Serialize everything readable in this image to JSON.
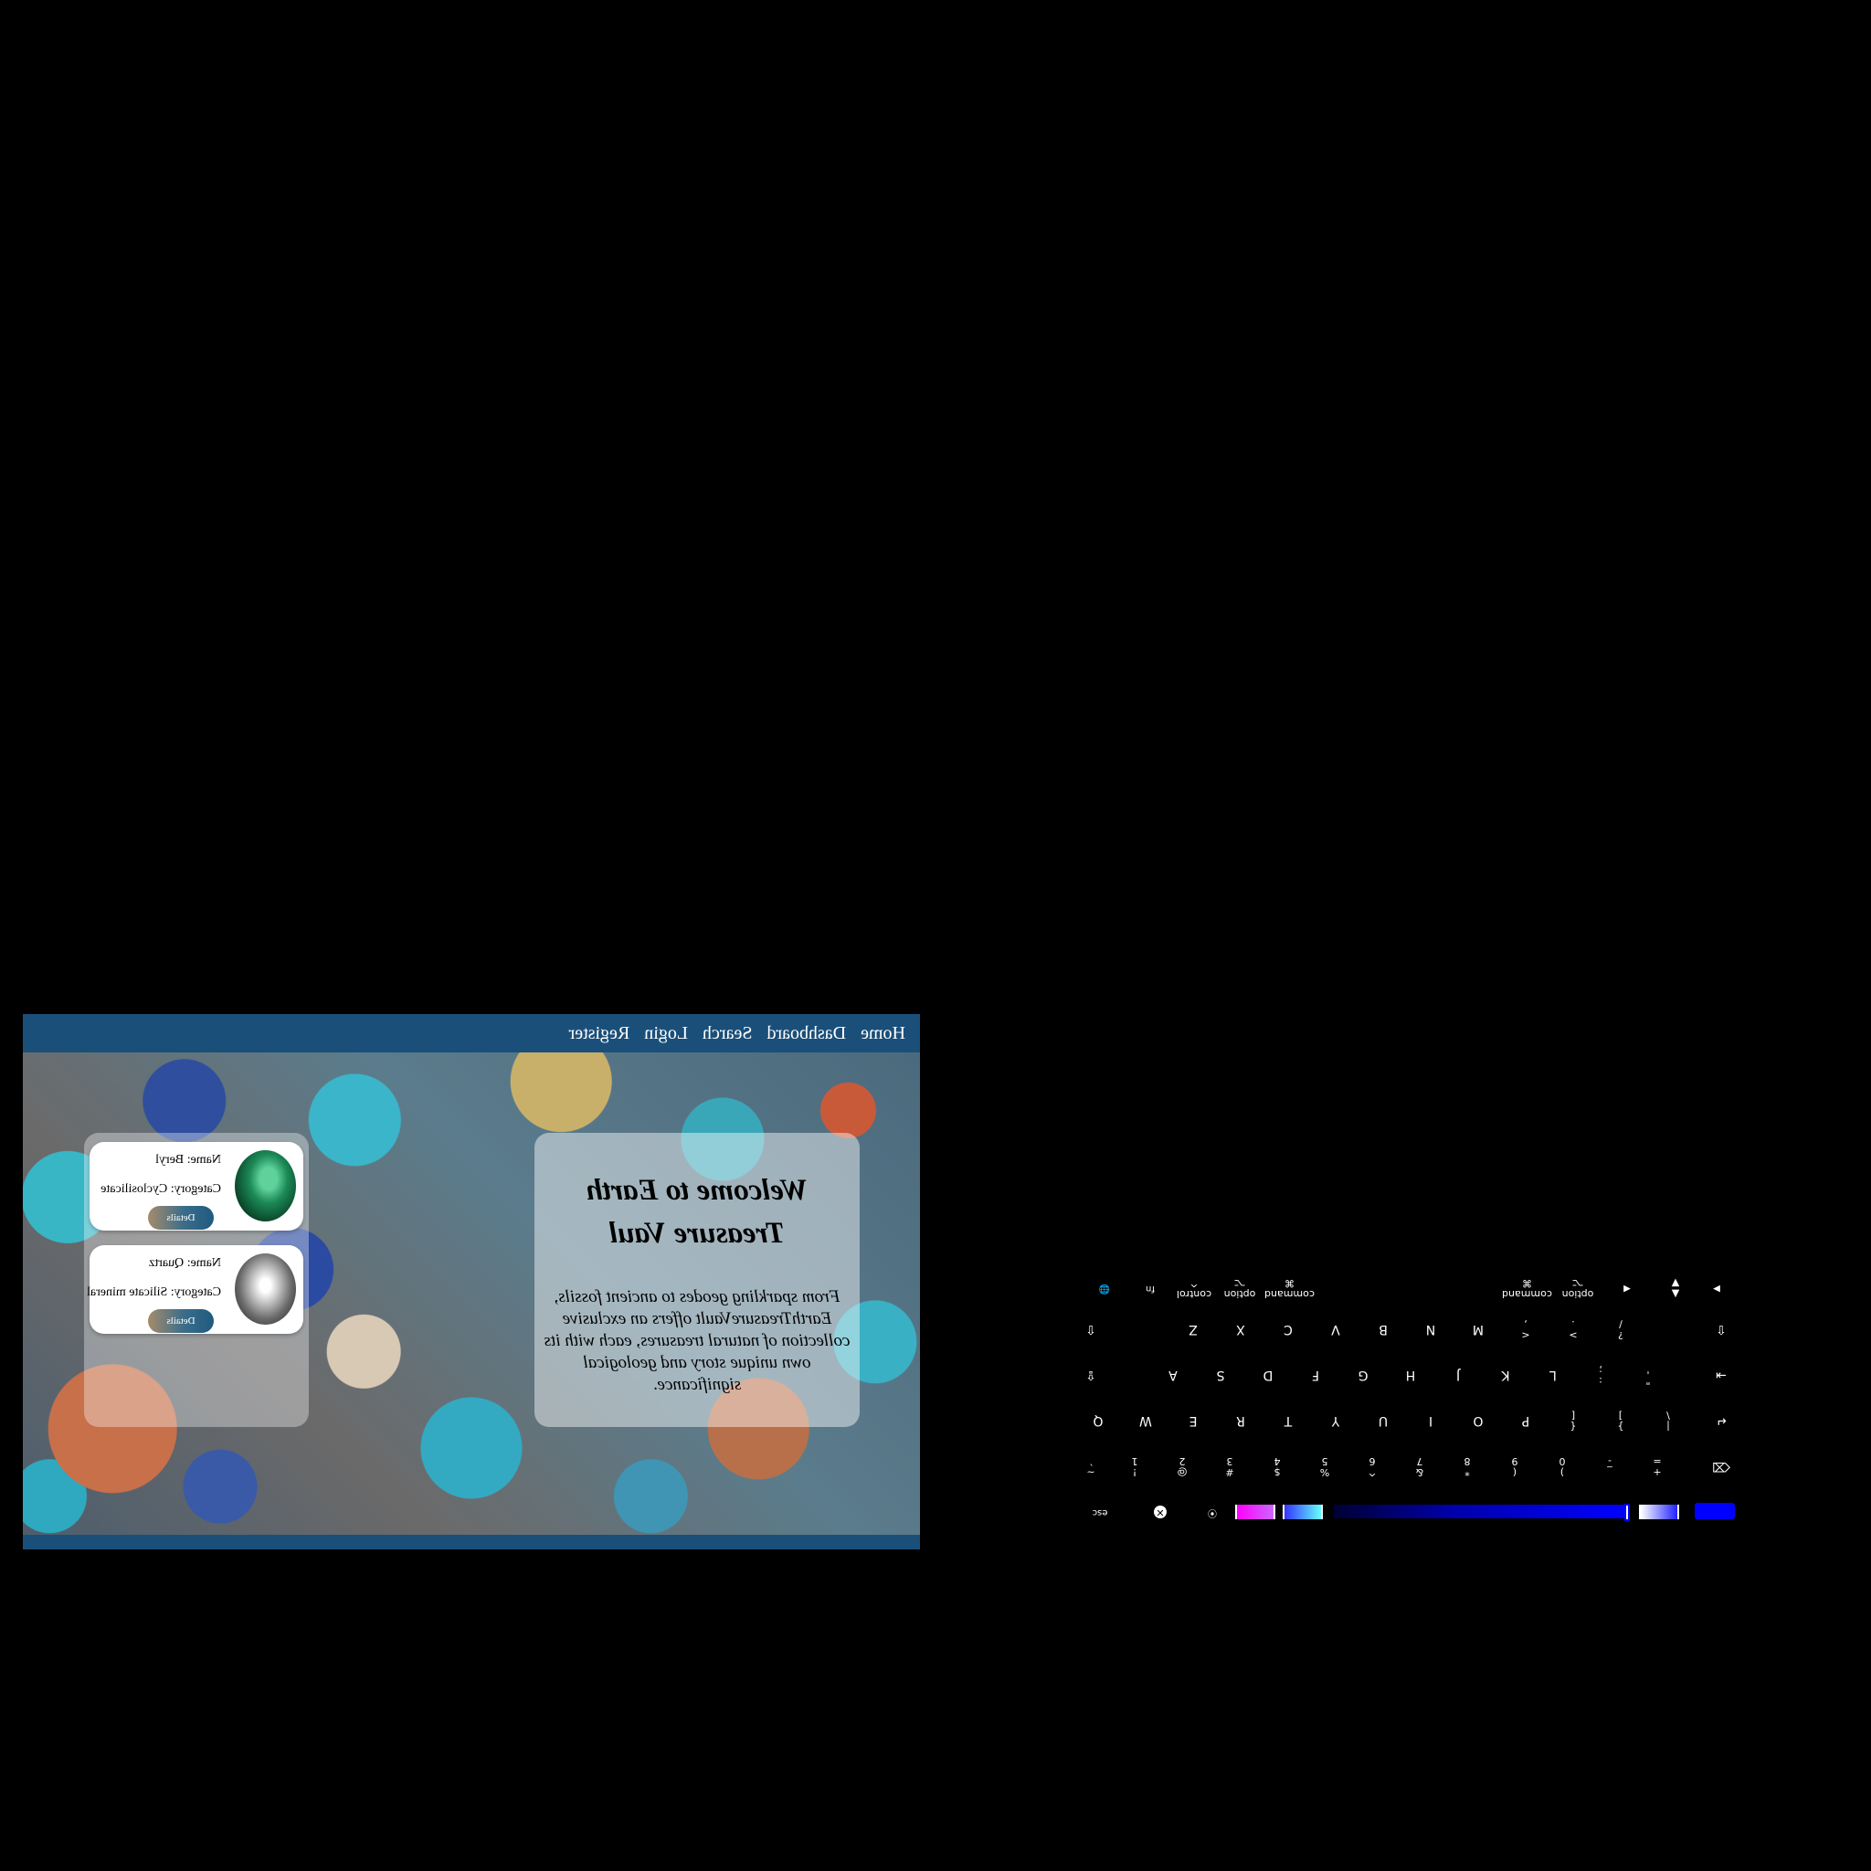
{
  "nav": {
    "items": [
      "Home",
      "Dashboard",
      "Search",
      "Login",
      "Register"
    ]
  },
  "welcome": {
    "title": "Welcome to Earth Treasure Vaul",
    "text": "From sparkling geodes to ancient fossils, EarthTreasureVault offers an exclusive collection of natural treasures, each with its own unique story and geological significance."
  },
  "gems": [
    {
      "name": "Name: Beryl",
      "category": "Category: Cyclosilicate",
      "button": "Details"
    },
    {
      "name": "Name: Quartz",
      "category": "Category: Silicate mineral",
      "button": "Details"
    }
  ],
  "keyboard": {
    "row_numbers": [
      {
        "top": "~",
        "bot": "`"
      },
      {
        "top": "!",
        "bot": "1"
      },
      {
        "top": "@",
        "bot": "2"
      },
      {
        "top": "#",
        "bot": "3"
      },
      {
        "top": "$",
        "bot": "4"
      },
      {
        "top": "%",
        "bot": "5"
      },
      {
        "top": "^",
        "bot": "6"
      },
      {
        "top": "&",
        "bot": "7"
      },
      {
        "top": "*",
        "bot": "8"
      },
      {
        "top": "(",
        "bot": "9"
      },
      {
        "top": ")",
        "bot": "0"
      },
      {
        "top": "_",
        "bot": "-"
      },
      {
        "top": "+",
        "bot": "="
      }
    ],
    "backspace": "⌫",
    "tab": "⇥",
    "row_q": [
      "Q",
      "W",
      "E",
      "R",
      "T",
      "Y",
      "U",
      "I",
      "O",
      "P"
    ],
    "row_q_extra": [
      {
        "top": "{",
        "bot": "["
      },
      {
        "top": "}",
        "bot": "]"
      },
      {
        "top": "|",
        "bot": "\\"
      }
    ],
    "return": "↵",
    "caps": "⇪",
    "row_a": [
      "A",
      "S",
      "D",
      "F",
      "G",
      "H",
      "J",
      "K",
      "L"
    ],
    "row_a_extra": [
      {
        "top": ":",
        "bot": ";"
      },
      {
        "top": "\"",
        "bot": "'"
      }
    ],
    "shift": "⇧",
    "row_z": [
      "Z",
      "X",
      "C",
      "V",
      "B",
      "N",
      "M"
    ],
    "row_z_extra": [
      {
        "top": "<",
        "bot": ","
      },
      {
        "top": ">",
        "bot": "."
      },
      {
        "top": "?",
        "bot": "/"
      }
    ],
    "fn": "fn",
    "globe": "🌐",
    "control": {
      "top": "control",
      "bot": "^"
    },
    "option": {
      "top": "option",
      "bot": "⌥"
    },
    "command": {
      "top": "command",
      "bot": "⌘"
    },
    "arrows": {
      "left": "◀",
      "up": "▲",
      "down": "▼",
      "right": "▶"
    },
    "esc": "esc",
    "close_glyph": "✕",
    "colors": {
      "magenta_start": "#ff00ff",
      "magenta_end": "#cc66ff",
      "cyan_start": "#33ccff",
      "cyan_end": "#66ffff",
      "blue": "#0000ff"
    }
  }
}
